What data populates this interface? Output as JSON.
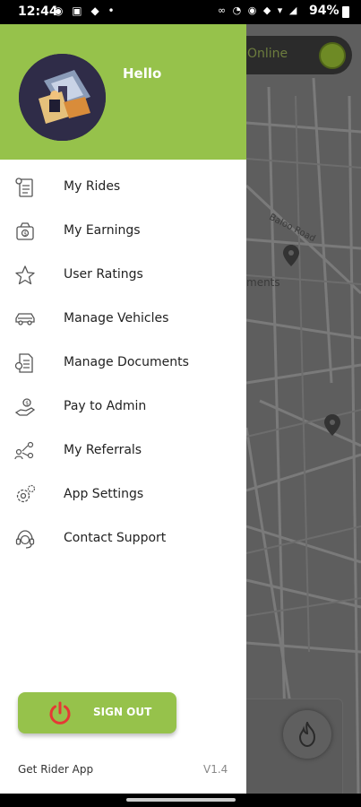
{
  "status_bar": {
    "time": "12:44",
    "left_icons": "◉ ▣ ◆ •",
    "right_icons": "∞ ◔ ◉ ◆ ▾ ◢",
    "battery": "94%"
  },
  "map": {
    "online_label": "Online",
    "road_label": "Baloo Road",
    "place_label": "ments"
  },
  "drawer": {
    "greeting": "Hello",
    "menu": [
      {
        "label": "My Rides",
        "icon": "rides-list-icon"
      },
      {
        "label": "My Earnings",
        "icon": "earnings-icon"
      },
      {
        "label": "User Ratings",
        "icon": "star-icon"
      },
      {
        "label": "Manage Vehicles",
        "icon": "car-icon"
      },
      {
        "label": "Manage Documents",
        "icon": "documents-icon"
      },
      {
        "label": "Pay to Admin",
        "icon": "pay-icon"
      },
      {
        "label": "My Referrals",
        "icon": "referrals-icon"
      },
      {
        "label": "App Settings",
        "icon": "gear-icon"
      },
      {
        "label": "Contact Support",
        "icon": "headset-icon"
      }
    ],
    "signout_label": "SIGN OUT",
    "get_rider_label": "Get Rider App",
    "version": "V1.4"
  },
  "colors": {
    "accent": "#96c24b",
    "power_icon": "#e53935",
    "map": "#5e5e5e"
  }
}
